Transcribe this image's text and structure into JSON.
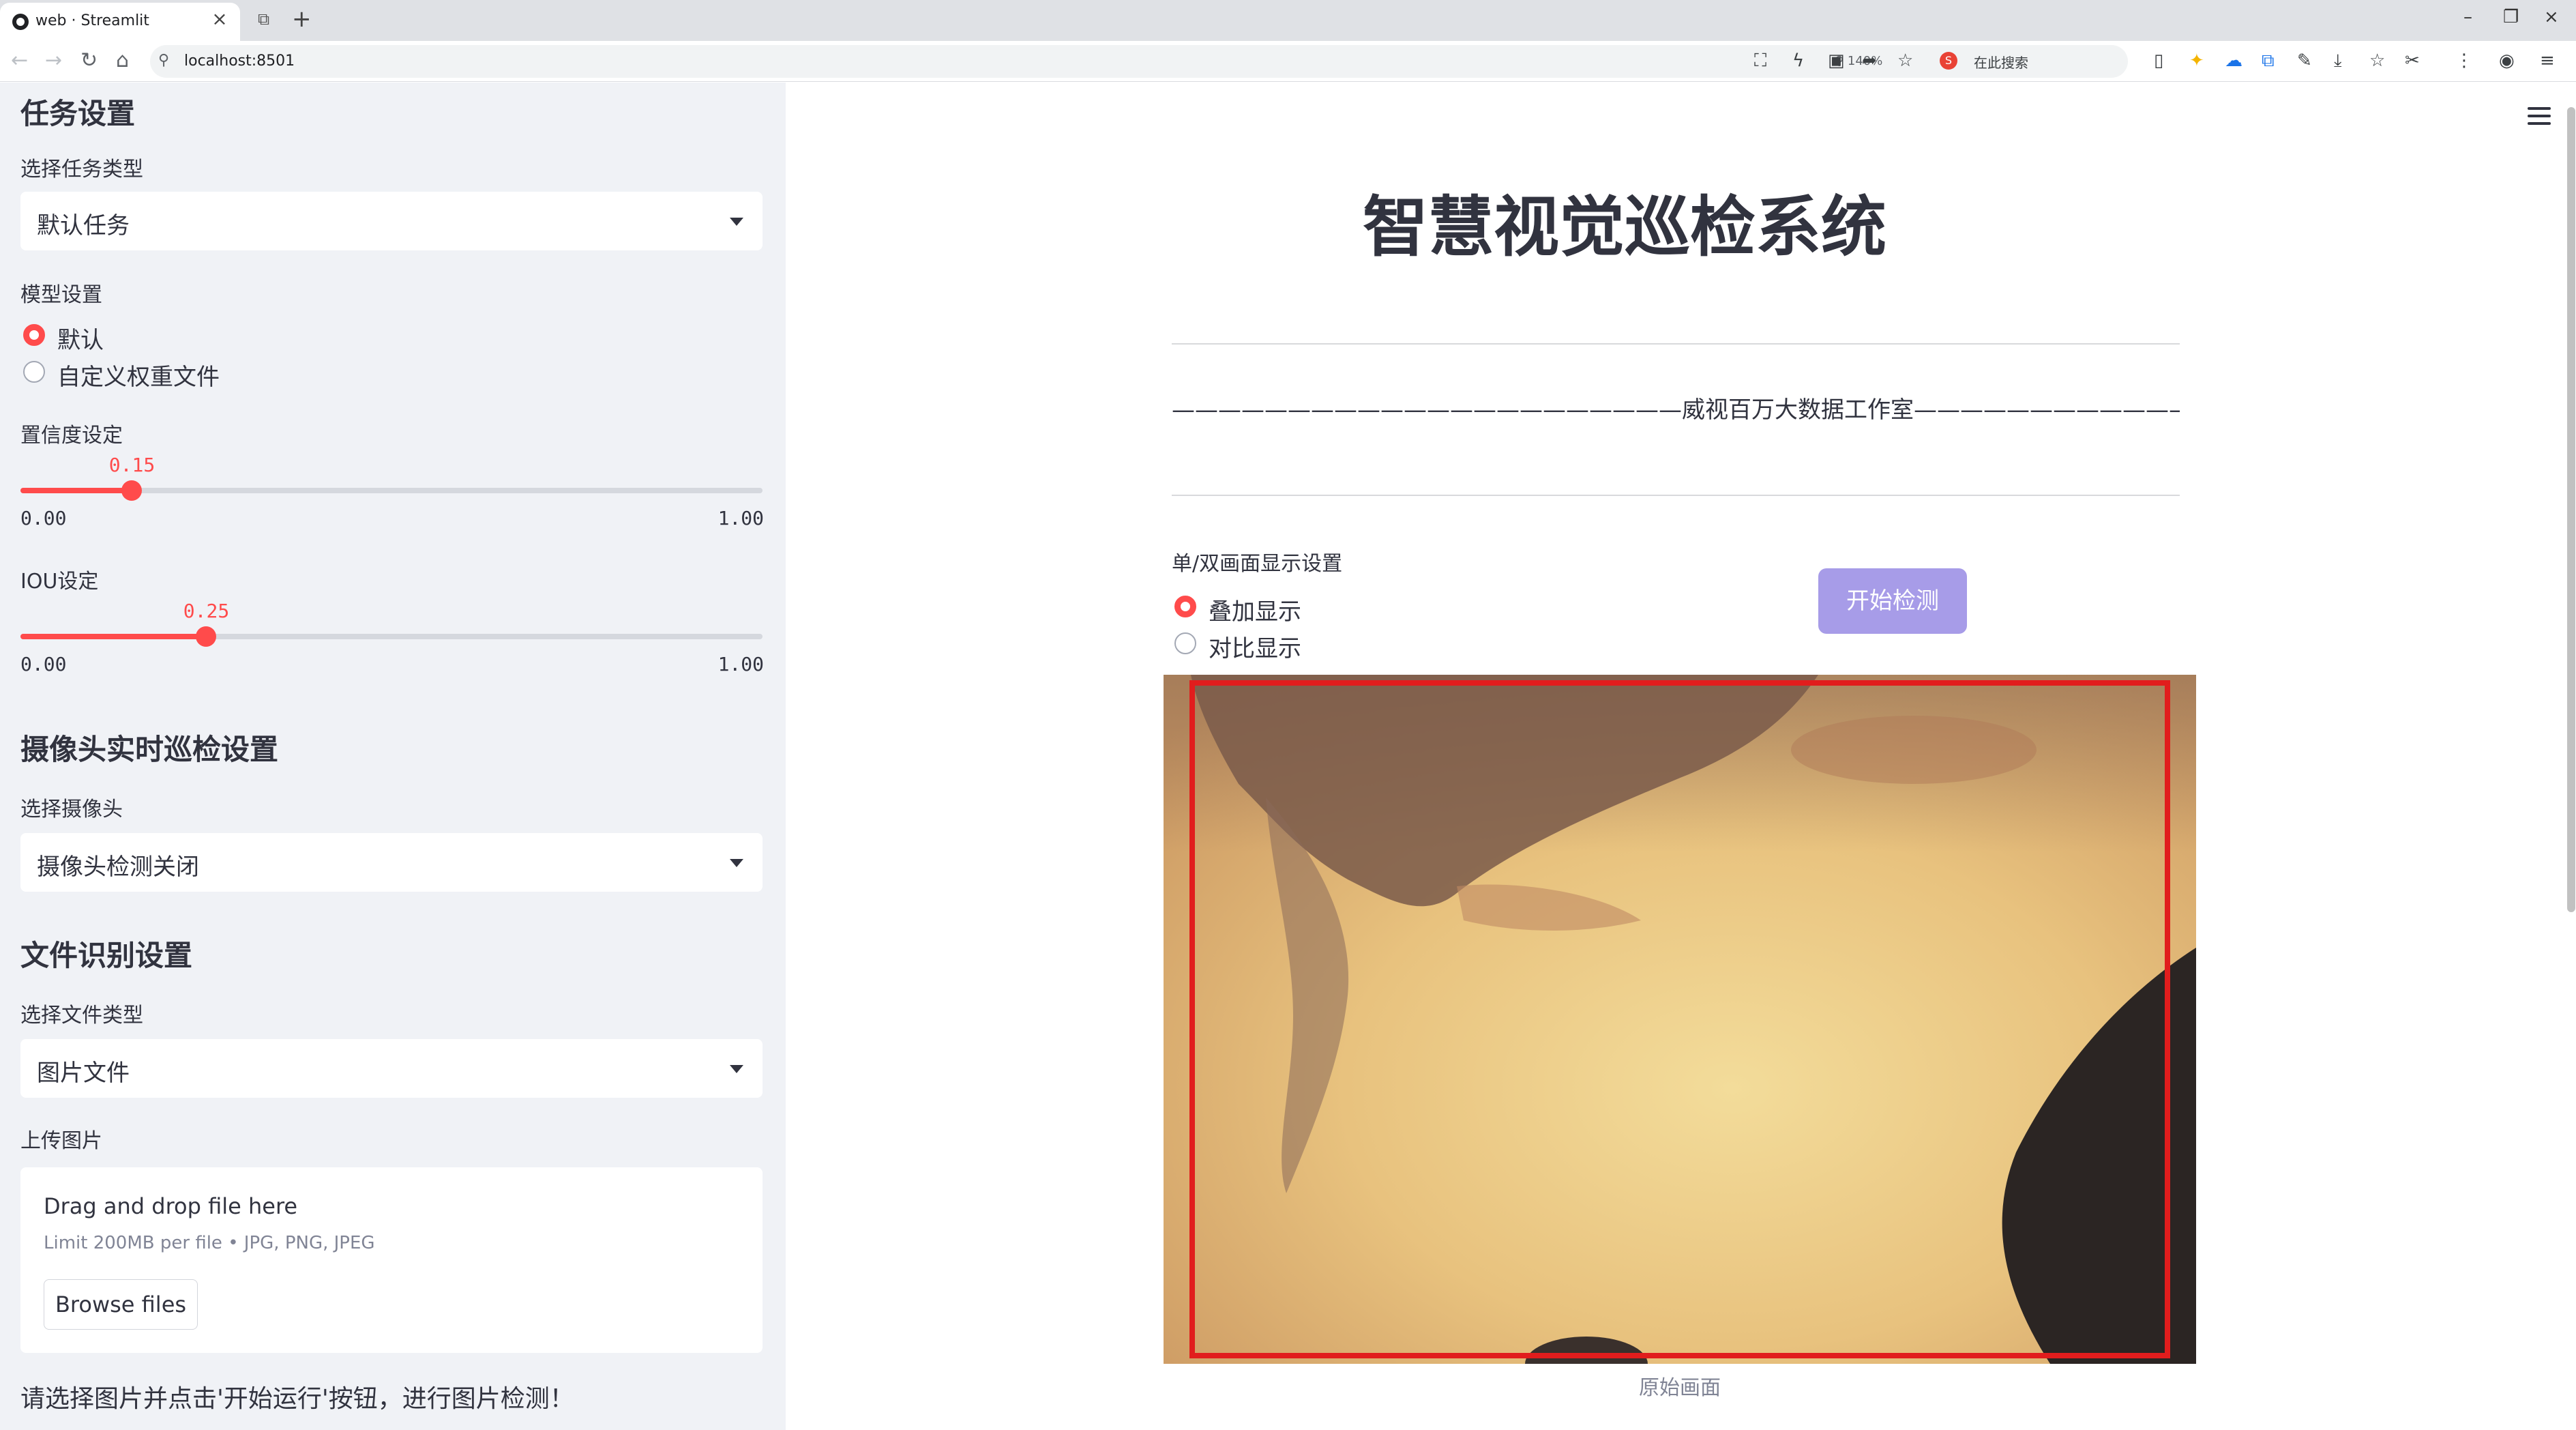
{
  "browser": {
    "tab_title": "web · Streamlit",
    "tab_close": "×",
    "new_tab": "+",
    "url": "localhost:8501",
    "zoom": "140%",
    "search_placeholder": "在此搜索",
    "window_controls": [
      "–",
      "❐",
      "×"
    ]
  },
  "sidebar": {
    "task_heading": "任务设置",
    "task_type_label": "选择任务类型",
    "task_type_value": "默认任务",
    "model_label": "模型设置",
    "model_options": [
      "默认",
      "自定义权重文件"
    ],
    "model_selected": 0,
    "conf_label": "置信度设定",
    "conf": {
      "value": 0.15,
      "value_text": "0.15",
      "min": "0.00",
      "max": "1.00"
    },
    "iou_label": "IOU设定",
    "iou": {
      "value": 0.25,
      "value_text": "0.25",
      "min": "0.00",
      "max": "1.00"
    },
    "camera_heading": "摄像头实时巡检设置",
    "camera_label": "选择摄像头",
    "camera_value": "摄像头检测关闭",
    "file_heading": "文件识别设置",
    "file_type_label": "选择文件类型",
    "file_type_value": "图片文件",
    "upload_label": "上传图片",
    "uploader": {
      "main_text": "Drag and drop file here",
      "limit_text": "Limit 200MB per file • JPG, PNG, JPEG",
      "button": "Browse files"
    },
    "note": "请选择图片并点击'开始运行'按钮，进行图片检测！"
  },
  "main": {
    "title": "智慧视觉巡检系统",
    "studio_line": "——————————————————————威视百万大数据工作室———————————————————————",
    "display_label": "单/双画面显示设置",
    "display_options": [
      "叠加显示",
      "对比显示"
    ],
    "display_selected": 0,
    "start_button": "开始检测",
    "image_caption": "原始画面"
  },
  "colors": {
    "accent": "#ff4b4b",
    "sidebar_bg": "#f0f2f6",
    "button": "#a79ce8",
    "detection_box": "#e11d1d"
  }
}
